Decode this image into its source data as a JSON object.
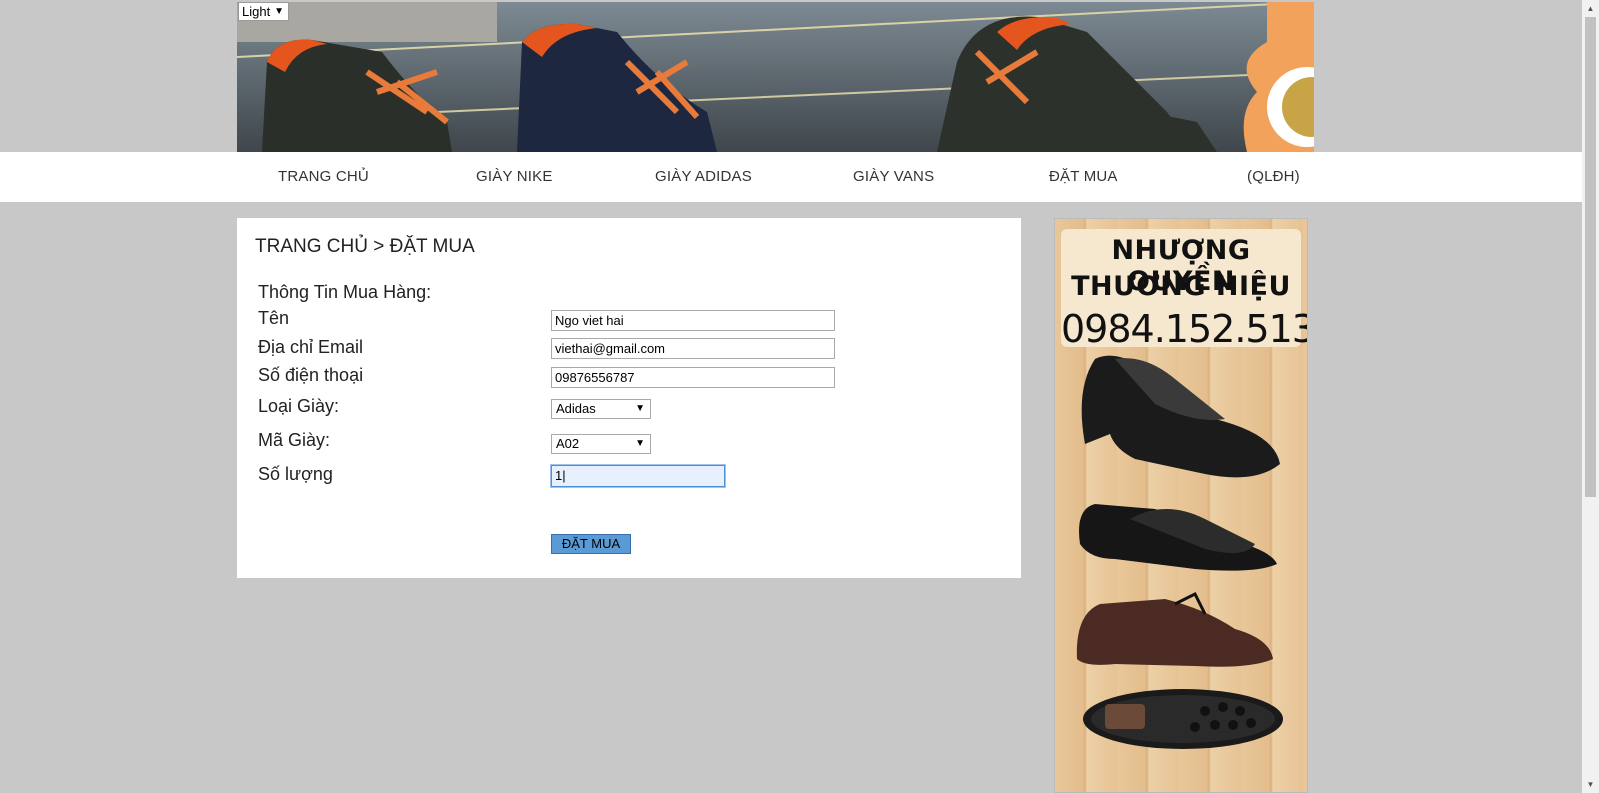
{
  "theme_select": {
    "value": "Light"
  },
  "nav": {
    "items": [
      "TRANG CHỦ",
      "GIÀY NIKE",
      "GIÀY ADIDAS",
      "GIÀY VANS",
      "ĐẶT MUA",
      "(QLĐH)"
    ]
  },
  "breadcrumb": "TRANG CHỦ > ĐẶT MUA",
  "form": {
    "heading": "Thông Tin Mua Hàng:",
    "name_label": "Tên",
    "name_value": "Ngo viet hai",
    "email_label": "Địa chỉ Email",
    "email_value": "viethai@gmail.com",
    "phone_label": "Số điện thoại",
    "phone_value": "09876556787",
    "shoe_type_label": "Loại Giày:",
    "shoe_type_value": "Adidas",
    "shoe_code_label": "Mã Giày:",
    "shoe_code_value": "A02",
    "quantity_label": "Số lượng",
    "quantity_value": "1",
    "submit_label": "ĐẶT MUA"
  },
  "ad": {
    "line1": "NHƯỢNG QUYỀN",
    "line2": "THƯƠNG HIỆU",
    "phone": "0984.152.513"
  },
  "colors": {
    "page_bg": "#c8c8c8",
    "button_bg": "#5b9bd5",
    "focus_input_bg": "#e8f0fe"
  }
}
